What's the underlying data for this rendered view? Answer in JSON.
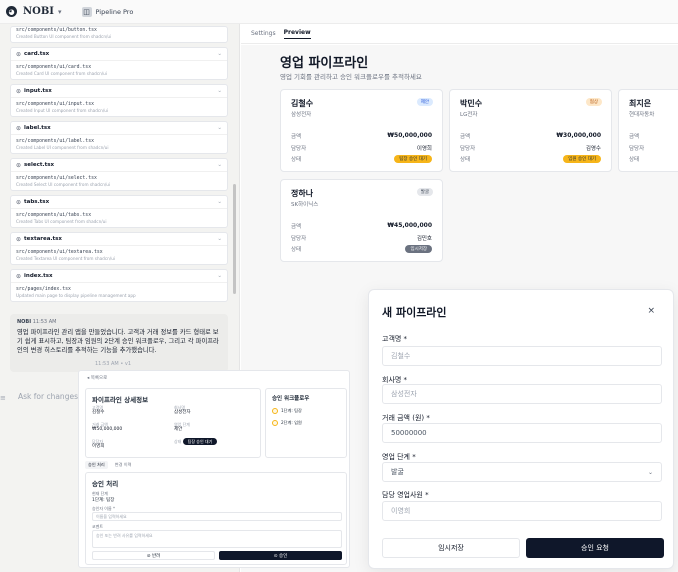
{
  "topbar": {
    "brand": "NOBI",
    "project": "Pipeline Pro"
  },
  "files": [
    {
      "name": "",
      "path": "src/components/ui/button.tsx",
      "desc": "Created Button UI component from shadcn/ui"
    },
    {
      "name": "card.tsx",
      "path": "src/components/ui/card.tsx",
      "desc": "Created Card UI component from shadcn/ui"
    },
    {
      "name": "input.tsx",
      "path": "src/components/ui/input.tsx",
      "desc": "Created Input UI component from shadcn/ui"
    },
    {
      "name": "label.tsx",
      "path": "src/components/ui/label.tsx",
      "desc": "Created Label UI component from shadcn/ui"
    },
    {
      "name": "select.tsx",
      "path": "src/components/ui/select.tsx",
      "desc": "Created Select UI component from shadcn/ui"
    },
    {
      "name": "tabs.tsx",
      "path": "src/components/ui/tabs.tsx",
      "desc": "Created Tabs UI component from shadcn/ui"
    },
    {
      "name": "textarea.tsx",
      "path": "src/components/ui/textarea.tsx",
      "desc": "Created Textarea UI component from shadcn/ui"
    },
    {
      "name": "index.tsx",
      "path": "src/pages/index.tsx",
      "desc": "Updated main page to display pipeline management app"
    }
  ],
  "message": {
    "author": "NOBI",
    "time": "11:53 AM",
    "body": "영업 파이프라인 관리 앱을 만들었습니다. 고객과 거래 정보를 카드 형태로 보기 쉽게 표시하고, 팀장과 임원의 2단계 승인 워크플로우, 그리고 각 파이프라인의 변경 히스토리를 추적하는 기능을 추가했습니다."
  },
  "timeline": "11:53 AM  •  v1",
  "ask_placeholder": "Ask for changes...",
  "preview_tabs": [
    "Settings",
    "Preview"
  ],
  "page": {
    "title": "영업 파이프라인",
    "subtitle": "영업 기회를 관리하고 승인 워크플로우를 추적하세요"
  },
  "cards": [
    {
      "name": "김철수",
      "company": "삼성전자",
      "badge": "제안",
      "amount_label": "금액",
      "amount": "₩50,000,000",
      "rep_label": "담당자",
      "rep": "이영희",
      "status_label": "상태",
      "status": "팀장 승인 대기"
    },
    {
      "name": "박민수",
      "company": "LG전자",
      "badge": "협상",
      "amount_label": "금액",
      "amount": "₩30,000,000",
      "rep_label": "담당자",
      "rep": "김영수",
      "status_label": "상태",
      "status": "임원 승인 대기"
    },
    {
      "name": "최지은",
      "company": "현대자동차",
      "badge": "",
      "amount_label": "금액",
      "amount": "",
      "rep_label": "담당자",
      "rep": "",
      "status_label": "상태",
      "status": ""
    },
    {
      "name": "정하나",
      "company": "SK하이닉스",
      "badge": "발굴",
      "amount_label": "금액",
      "amount": "₩45,000,000",
      "rep_label": "담당자",
      "rep": "김민호",
      "status_label": "상태",
      "status": "임시저장"
    }
  ],
  "detail": {
    "crumb": "◂ 목록으로",
    "title": "파이프라인 상세정보",
    "fields": [
      {
        "label": "고객명",
        "value": "김철수"
      },
      {
        "label": "회사명",
        "value": "삼성전자"
      },
      {
        "label": "거래 금액",
        "value": "₩50,000,000"
      },
      {
        "label": "영업 단계",
        "value": "제안"
      },
      {
        "label": "담당자",
        "value": "이영희"
      },
      {
        "label": "상태",
        "value": ""
      }
    ],
    "status_pill": "팀장 승인 대기",
    "flow_title": "승인 워크플로우",
    "flow": [
      "1단계: 팀장",
      "2단계: 임원"
    ],
    "tabs": [
      "승인 처리",
      "변경 이력"
    ],
    "approve_title": "승인 처리",
    "current_label": "현재 단계",
    "current_value": "1단계: 팀장",
    "approver_label": "승인자 이름 *",
    "approver_placeholder": "이름을 입력하세요",
    "comment_label": "코멘트",
    "comment_placeholder": "승인 또는 반려 사유를 입력하세요",
    "reject": "⊘ 반려",
    "approve": "⊙ 승인"
  },
  "modal": {
    "title": "새 파이프라인",
    "close": "×",
    "customer_label": "고객명 *",
    "customer_placeholder": "김철수",
    "company_label": "회사명 *",
    "company_placeholder": "삼성전자",
    "amount_label": "거래 금액 (원) *",
    "amount_value": "50000000",
    "stage_label": "영업 단계 *",
    "stage_value": "발굴",
    "rep_label": "담당 영업사원 *",
    "rep_placeholder": "이영희",
    "draft": "임시저장",
    "submit": "승인 요청"
  },
  "colors": {
    "accent_dark": "#0f172a",
    "pending": "#f6b519",
    "draft": "#6b7280"
  }
}
